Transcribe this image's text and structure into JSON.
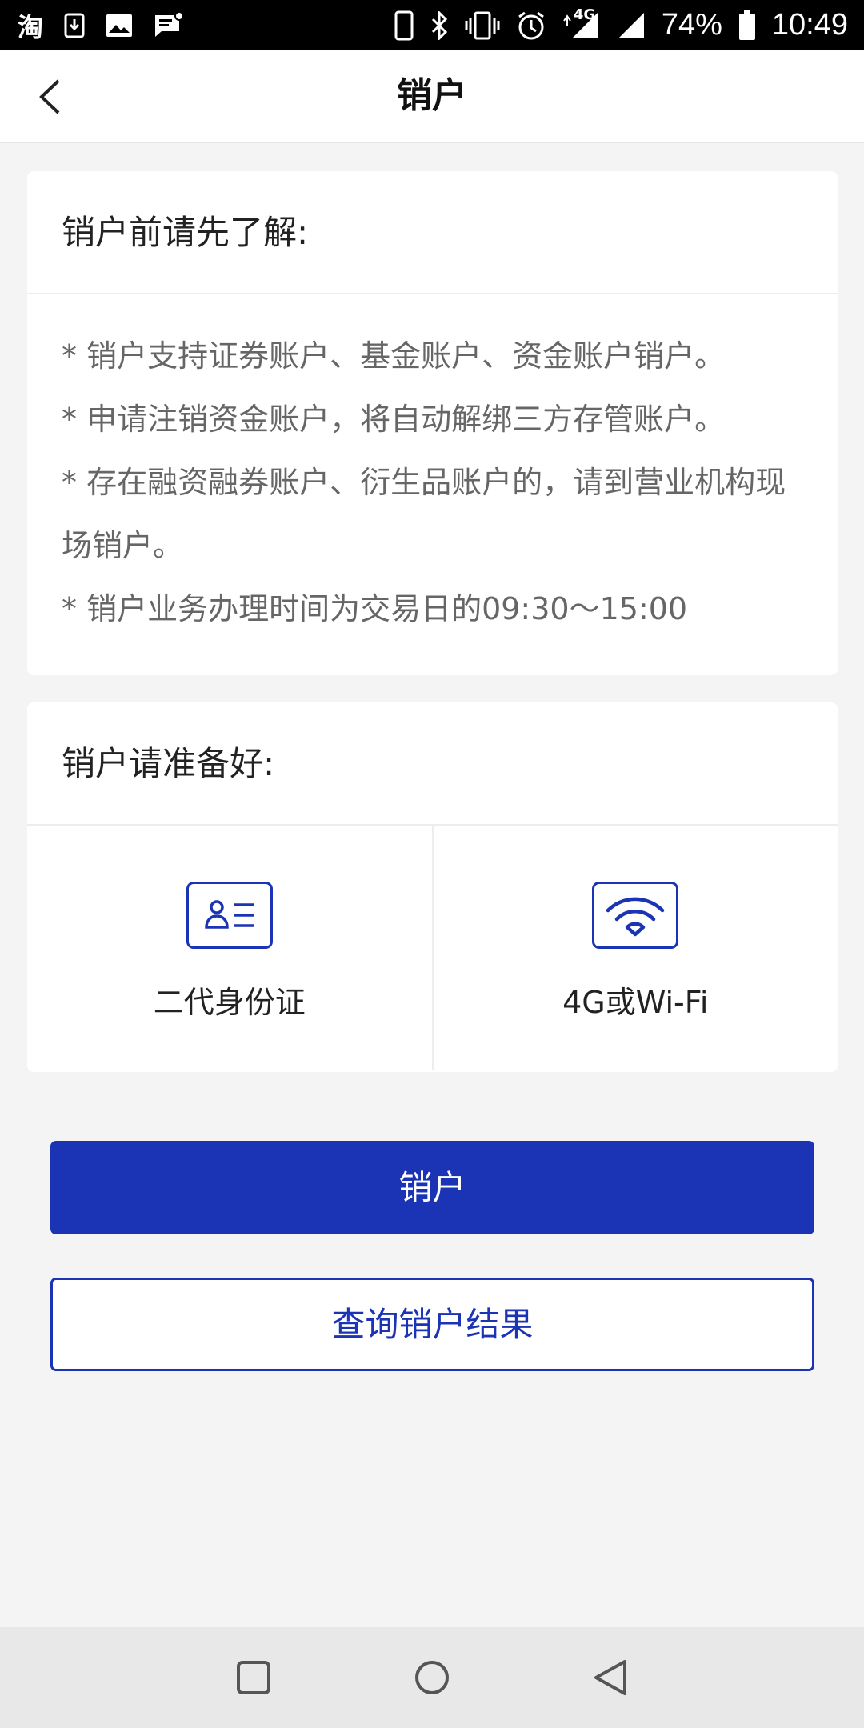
{
  "status_bar": {
    "left_icons": [
      "taobao-icon",
      "download-icon",
      "image-icon",
      "message-icon"
    ],
    "taobao_glyph": "淘",
    "network": "4G",
    "battery": "74%",
    "time": "10:49"
  },
  "header": {
    "title": "销户"
  },
  "notice": {
    "title": "销户前请先了解:",
    "items": [
      "* 销户支持证券账户、基金账户、资金账户销户。",
      "* 申请注销资金账户，将自动解绑三方存管账户。",
      "* 存在融资融券账户、衍生品账户的，请到营业机构现场销户。",
      "* 销户业务办理时间为交易日的09:30～15:00"
    ]
  },
  "prepare": {
    "title": "销户请准备好:",
    "items": [
      {
        "icon": "id-card-icon",
        "label": "二代身份证"
      },
      {
        "icon": "wifi-icon",
        "label": "4G或Wi-Fi"
      }
    ]
  },
  "actions": {
    "close_account_label": "销户",
    "query_result_label": "查询销户结果"
  },
  "colors": {
    "primary": "#1b33b5",
    "background": "#f4f4f5"
  }
}
